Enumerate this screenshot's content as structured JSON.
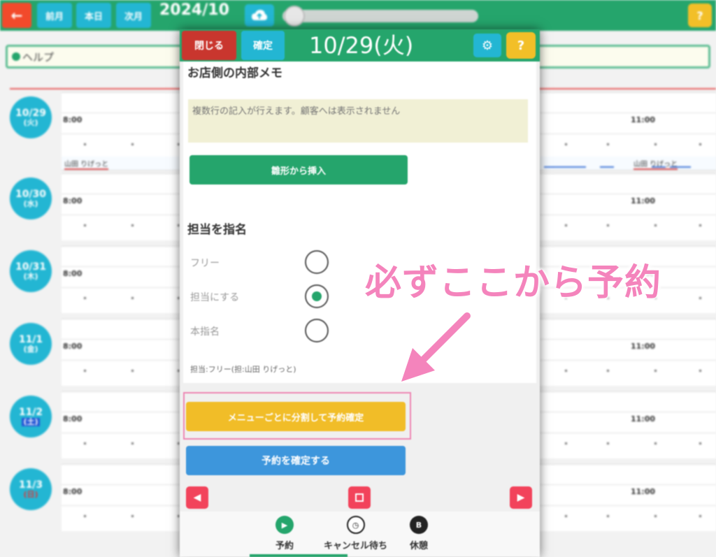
{
  "topbar": {
    "back_label": "←",
    "prev_month": "前月",
    "today": "本日",
    "next_month": "次月",
    "month_title": "2024/10",
    "help_label": "?"
  },
  "help_bar": {
    "label": "ヘルプ"
  },
  "calendar": {
    "days": [
      {
        "date": "10/29",
        "weekday": "(火)",
        "type": "weekday"
      },
      {
        "date": "10/30",
        "weekday": "(水)",
        "type": "weekday"
      },
      {
        "date": "10/31",
        "weekday": "(木)",
        "type": "weekday"
      },
      {
        "date": "11/1",
        "weekday": "(金)",
        "type": "weekday"
      },
      {
        "date": "11/2",
        "weekday": "(土)",
        "type": "sat"
      },
      {
        "date": "11/3",
        "weekday": "(日)",
        "type": "sun"
      }
    ],
    "time_left": "8:00",
    "time_right": "11:00",
    "reservation_name": "山田 りげっと"
  },
  "modal": {
    "close_label": "閉じる",
    "confirm_label": "確定",
    "date_title": "10/29(火)",
    "help_label": "?",
    "memo_section": {
      "title": "お店側の内部メモ",
      "placeholder": "複数行の記入が行えます。顧客へは表示されません",
      "template_button": "雛形から挿入"
    },
    "assign_section": {
      "title": "担当を指名",
      "options": [
        {
          "label": "フリー",
          "selected": false
        },
        {
          "label": "担当にする",
          "selected": true
        },
        {
          "label": "本指名",
          "selected": false
        }
      ],
      "note": "担当:フリー(担:山田 りげっと)"
    },
    "split_button": "メニューごとに分割して予約確定",
    "book_button": "予約を確定する",
    "tabs": [
      {
        "label": "予約"
      },
      {
        "label": "キャンセル待ち"
      },
      {
        "label": "休憩"
      }
    ],
    "tab_icon_break": "B"
  },
  "annotation": {
    "text": "必ずここから予約",
    "color": "#f484bc"
  },
  "colors": {
    "green": "#25a56c",
    "cyan": "#23b6d3",
    "yellow": "#f1bd28",
    "red": "#c9362e",
    "blue": "#3d96dc",
    "pink": "#ee86b4"
  }
}
